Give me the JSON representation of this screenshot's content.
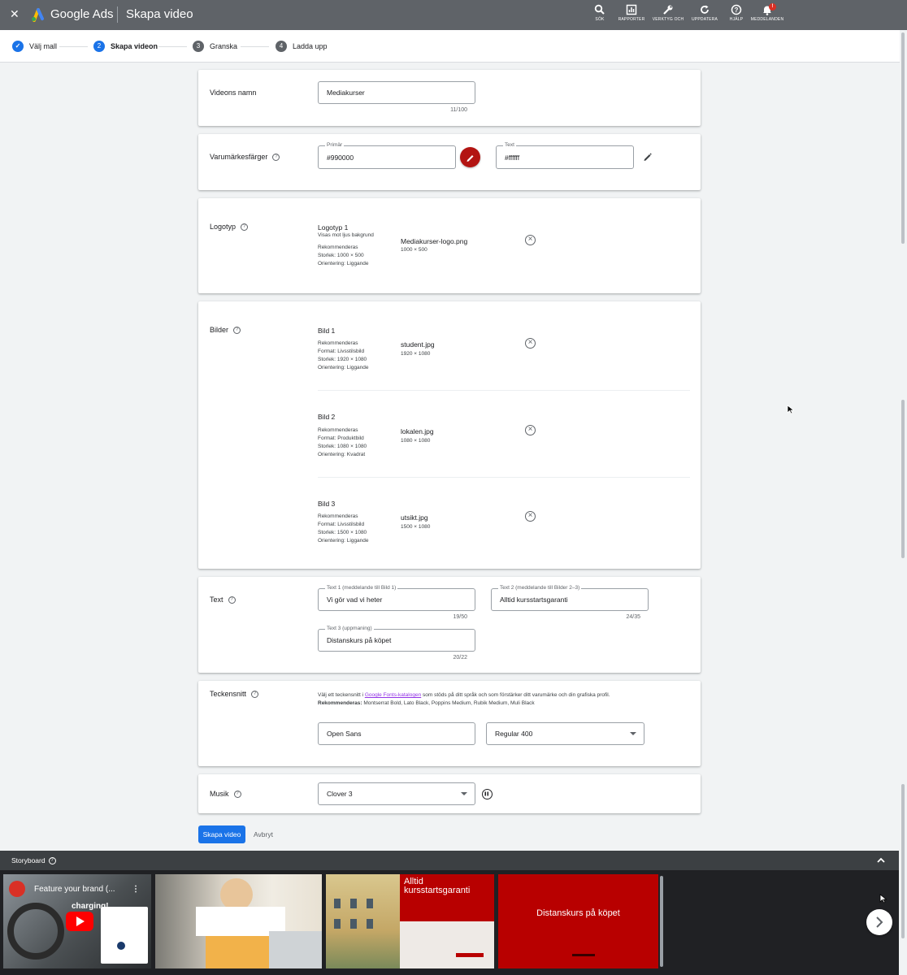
{
  "topbar": {
    "close_label": "✕",
    "product_name": "Google Ads",
    "page_title": "Skapa video",
    "actions": [
      {
        "icon": "search-icon",
        "label": "SÖK"
      },
      {
        "icon": "reports-icon",
        "label": "RAPPORTER"
      },
      {
        "icon": "tools-icon",
        "label": "VERKTYG OCH"
      },
      {
        "icon": "refresh-icon",
        "label": "UPPDATERA"
      },
      {
        "icon": "help-icon",
        "label": "HJÄLP"
      },
      {
        "icon": "bell-icon",
        "label": "MEDDELANDEN",
        "badge": "!"
      }
    ]
  },
  "stepper": {
    "steps": [
      {
        "num": "✓",
        "label": "Välj mall",
        "state": "done"
      },
      {
        "num": "2",
        "label": "Skapa videon",
        "state": "current"
      },
      {
        "num": "3",
        "label": "Granska",
        "state": "todo"
      },
      {
        "num": "4",
        "label": "Ladda upp",
        "state": "todo"
      }
    ]
  },
  "video_name": {
    "label": "Videons namn",
    "value": "Mediakurser",
    "counter": "11/100"
  },
  "brand_colors": {
    "label": "Varumärkesfärger",
    "primary_label": "Primär",
    "primary_value": "#990000",
    "text_label": "Text",
    "text_value": "#ffffff",
    "primary_swatch": "#b31412"
  },
  "logo": {
    "label": "Logotyp",
    "slot_title": "Logotyp 1",
    "slot_sub": "Visas mot ljus bakgrund",
    "rec_lines": [
      "Rekommenderas",
      "Storlek: 1000 × 500",
      "Orientering: Liggande"
    ],
    "file_name": "Mediakurser-logo.png",
    "file_size": "1000 × 500"
  },
  "images": {
    "label": "Bilder",
    "items": [
      {
        "title": "Bild 1",
        "rec_lines": [
          "Rekommenderas",
          "Format: Livsstilsbild",
          "Storlek: 1920 × 1080",
          "Orientering: Liggande"
        ],
        "file_name": "student.jpg",
        "file_size": "1920 × 1080"
      },
      {
        "title": "Bild 2",
        "rec_lines": [
          "Rekommenderas",
          "Format: Produktbild",
          "Storlek: 1080 × 1080",
          "Orientering: Kvadrat"
        ],
        "file_name": "lokalen.jpg",
        "file_size": "1080 × 1080"
      },
      {
        "title": "Bild 3",
        "rec_lines": [
          "Rekommenderas",
          "Format: Livsstilsbild",
          "Storlek: 1500 × 1080",
          "Orientering: Liggande"
        ],
        "file_name": "utsikt.jpg",
        "file_size": "1500 × 1080"
      }
    ]
  },
  "text": {
    "label": "Text",
    "text1": {
      "label": "Text 1 (meddelande till Bild 1)",
      "value": "Vi gör vad vi heter",
      "counter": "19/50"
    },
    "text2": {
      "label": "Text 2 (meddelande till Bilder 2–3)",
      "value": "Alltid kursstartsgaranti",
      "counter": "24/35"
    },
    "text3": {
      "label": "Text 3 (uppmaning)",
      "value": "Distanskurs på köpet",
      "counter": "20/22"
    }
  },
  "font": {
    "label": "Teckensnitt",
    "desc_before": "Välj ett teckensnitt i ",
    "desc_link": "Google Fonts-katalogen",
    "desc_after": " som stöds på ditt språk och som förstärker ditt varumärke och din grafiska profil.",
    "rec_bold": "Rekommenderas:",
    "rec_list": " Montserrat Bold, Lato Black, Poppins Medium, Rubik Medium, Muli Black",
    "family_value": "Open Sans",
    "weight_value": "Regular 400"
  },
  "music": {
    "label": "Musik",
    "value": "Clover 3"
  },
  "actions": {
    "create_label": "Skapa video",
    "cancel_label": "Avbryt"
  },
  "storyboard": {
    "title": "Storyboard",
    "video_title": "Feature your brand (...",
    "video_overlay": "charging!",
    "thumb3_text": "Alltid kursstartsgaranti",
    "thumb4_text": "Distanskurs på köpet"
  },
  "colors": {
    "accent": "#1a73e8",
    "brand_red": "#b80000",
    "topbar": "#5f6368"
  }
}
